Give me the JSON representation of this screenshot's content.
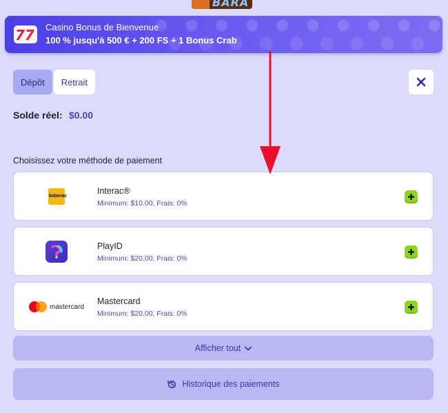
{
  "header": {
    "logo_text": "BARA",
    "logo_icon": "brand-logo"
  },
  "banner": {
    "title": "Casino Bonus de Bienvenue",
    "offer": "100 % jusqu'à 500 € + 200 FS + 1 Bonus Crab",
    "icon": "sevens-slot-icon",
    "color": "#5247ea"
  },
  "tabs": [
    {
      "label": "Dépôt",
      "active": true
    },
    {
      "label": "Retrait",
      "active": false
    }
  ],
  "close_icon": "close-icon",
  "balance": {
    "label": "Solde réel:",
    "value": "$0.00"
  },
  "methods_title": "Choisissez votre méthode de paiement",
  "methods": [
    {
      "name": "Interac®",
      "detail": "Minimum: $10.00, Frais: 0%",
      "logo_text": "Interac",
      "icon": "interac-logo"
    },
    {
      "name": "PlayID",
      "detail": "Minimum: $20.00, Frais: 0%",
      "icon": "playid-logo"
    },
    {
      "name": "Mastercard",
      "detail": "Minimum: $20.00, Frais: 0%",
      "logo_text": "mastercard",
      "icon": "mastercard-logo"
    }
  ],
  "show_all": {
    "label": "Afficher tout",
    "icon": "chevron-down-icon"
  },
  "history": {
    "label": "Historique des paiements",
    "icon": "history-icon"
  },
  "colors": {
    "accent": "#4a47b0",
    "add_button": "#8fd41f",
    "annotation_arrow": "#e8102a",
    "background": "#dcdbfb"
  }
}
